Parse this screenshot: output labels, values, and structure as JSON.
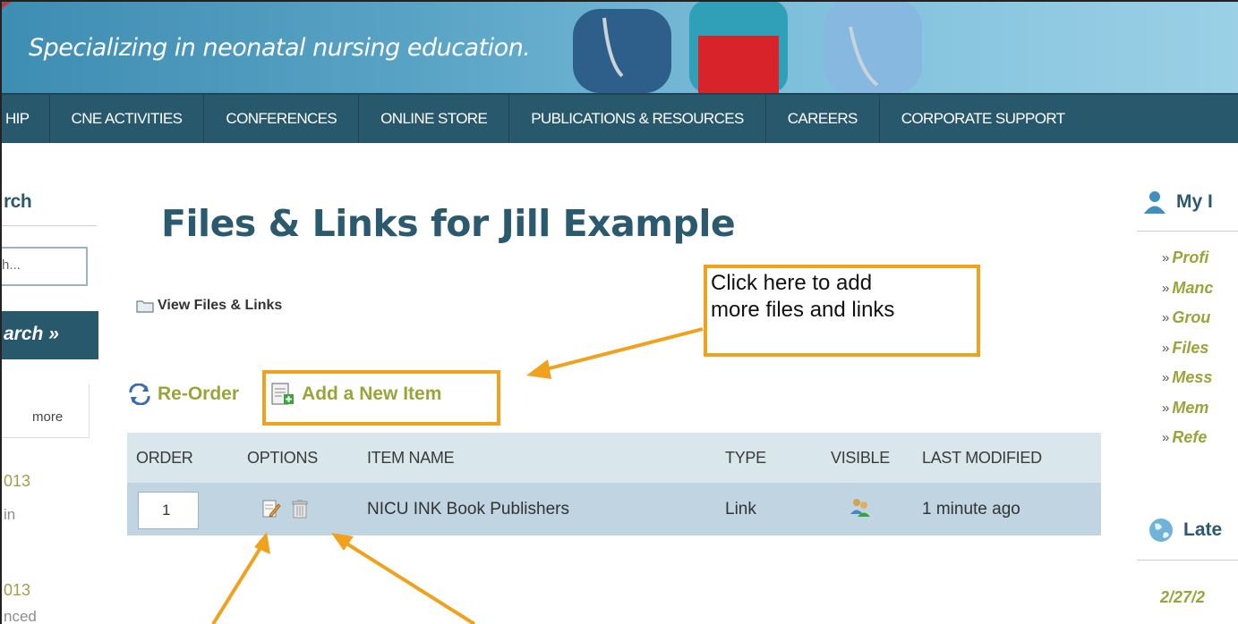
{
  "banner": {
    "tagline": "Specializing in neonatal nursing education."
  },
  "nav": {
    "items": [
      "HIP",
      "CNE ACTIVITIES",
      "CONFERENCES",
      "ONLINE STORE",
      "PUBLICATIONS & RESOURCES",
      "CAREERS",
      "CORPORATE SUPPORT"
    ]
  },
  "left_sidebar": {
    "heading": "rch",
    "search_placeholder": "h...",
    "search_button": "arch »",
    "more": "more",
    "items": [
      {
        "date": "013",
        "sub": "in"
      },
      {
        "date": "013",
        "sub": "nced"
      }
    ]
  },
  "main": {
    "title": "Files & Links for Jill Example",
    "view_files": "View Files & Links",
    "reorder": "Re-Order",
    "add_item": "Add a New Item",
    "table": {
      "headers": [
        "ORDER",
        "OPTIONS",
        "ITEM NAME",
        "TYPE",
        "VISIBLE",
        "LAST MODIFIED"
      ],
      "rows": [
        {
          "order": "1",
          "name": "NICU INK Book Publishers",
          "type": "Link",
          "modified": "1 minute ago"
        }
      ]
    }
  },
  "callout": {
    "line1": "Click here to add",
    "line2": "more files and links"
  },
  "right_sidebar": {
    "heading": "My I",
    "links": [
      "Profi",
      "Manc",
      "Grou",
      "Files",
      "Mess",
      "Mem",
      "Refe"
    ],
    "latest_heading": "Late",
    "latest_date": "2/27/2"
  },
  "colors": {
    "nav_bg": "#27586b",
    "title": "#2b5a6e",
    "accent_green": "#9ba43a",
    "highlight_orange": "#f0a21f",
    "table_header": "#d9e6ec",
    "table_row": "#c0d4e1"
  }
}
